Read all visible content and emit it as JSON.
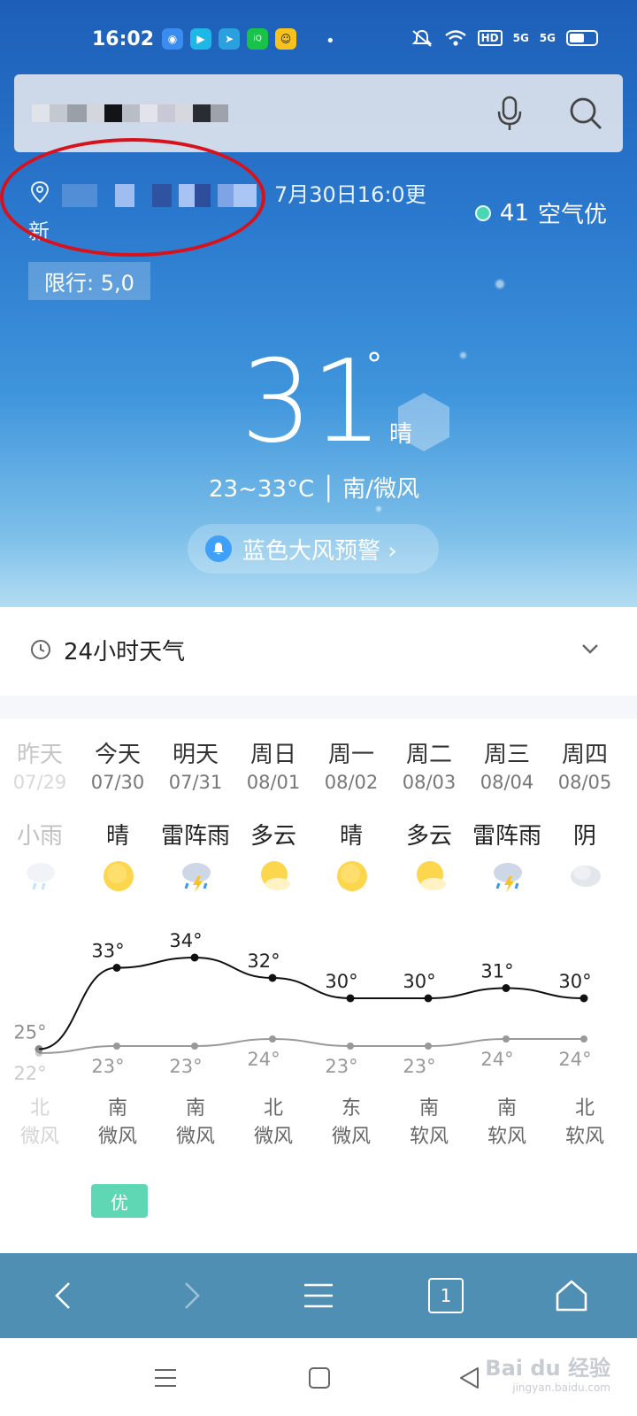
{
  "status_bar": {
    "time": "16:02",
    "hd_label": "HD",
    "signal_1": "5G",
    "signal_2": "5G"
  },
  "location": {
    "update_text_line1": "7月30日16:0更",
    "update_text_line2": "新"
  },
  "air_quality": {
    "value": "41",
    "label": "空气优",
    "color": "#49d6b4"
  },
  "restriction": "限行: 5,0",
  "current": {
    "temperature": "31",
    "degree_symbol": "°",
    "condition": "晴",
    "range_wind": "23~33°C │ 南/微风",
    "warning": "蓝色大风预警 ›"
  },
  "hourly_section": {
    "title": "24小时天气"
  },
  "forecast": [
    {
      "day": "昨天",
      "date": "07/29",
      "weather": "小雨",
      "high": 25,
      "low": 22,
      "high_label": "25°",
      "low_label": "22°",
      "wind_dir": "北",
      "wind_level": "微风",
      "icon": "rain-icon"
    },
    {
      "day": "今天",
      "date": "07/30",
      "weather": "晴",
      "high": 33,
      "low": 23,
      "high_label": "33°",
      "low_label": "23°",
      "wind_dir": "南",
      "wind_level": "微风",
      "icon": "sun-icon"
    },
    {
      "day": "明天",
      "date": "07/31",
      "weather": "雷阵雨",
      "high": 34,
      "low": 23,
      "high_label": "34°",
      "low_label": "23°",
      "wind_dir": "南",
      "wind_level": "微风",
      "icon": "thunderstorm-icon"
    },
    {
      "day": "周日",
      "date": "08/01",
      "weather": "多云",
      "high": 32,
      "low": 24,
      "high_label": "32°",
      "low_label": "24°",
      "wind_dir": "北",
      "wind_level": "微风",
      "icon": "partly-cloudy-icon"
    },
    {
      "day": "周一",
      "date": "08/02",
      "weather": "晴",
      "high": 30,
      "low": 23,
      "high_label": "30°",
      "low_label": "23°",
      "wind_dir": "东",
      "wind_level": "微风",
      "icon": "sun-icon"
    },
    {
      "day": "周二",
      "date": "08/03",
      "weather": "多云",
      "high": 30,
      "low": 23,
      "high_label": "30°",
      "low_label": "23°",
      "wind_dir": "南",
      "wind_level": "软风",
      "icon": "partly-cloudy-icon"
    },
    {
      "day": "周三",
      "date": "08/04",
      "weather": "雷阵雨",
      "high": 31,
      "low": 24,
      "high_label": "31°",
      "low_label": "24°",
      "wind_dir": "南",
      "wind_level": "软风",
      "icon": "thunderstorm-icon"
    },
    {
      "day": "周四",
      "date": "08/05",
      "weather": "阴",
      "high": 30,
      "low": 24,
      "high_label": "30°",
      "low_label": "24°",
      "wind_dir": "北",
      "wind_level": "软风",
      "icon": "overcast-icon"
    }
  ],
  "air_badge": "优",
  "browser_nav": {
    "tab_count": "1"
  },
  "watermark": {
    "brand": "Bai du 经验",
    "url": "jingyan.baidu.com"
  },
  "colors": {
    "hero_top": "#1d5fb8",
    "nav_bar": "#4f8fb4",
    "highlight_ellipse": "#d8121c"
  }
}
